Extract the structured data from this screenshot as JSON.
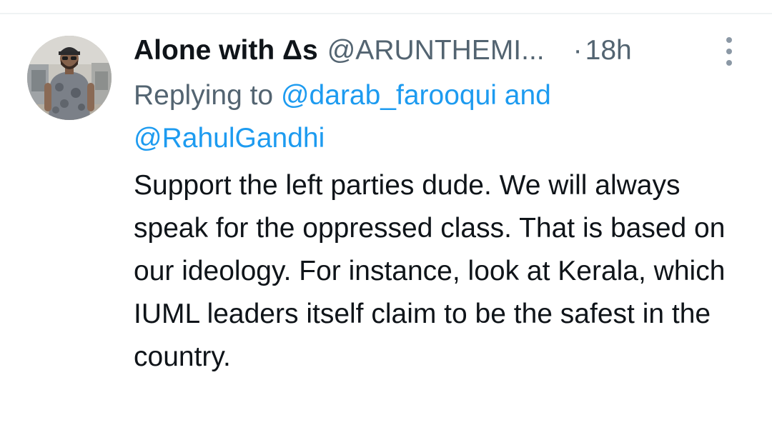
{
  "tweet": {
    "author": {
      "display_name": "Alone with Δs",
      "handle": "@ARUNTHEMI..."
    },
    "separator": "·",
    "timestamp": "18h",
    "more_icon": "more-vertical-icon",
    "reply_context": {
      "prefix": "Replying to",
      "mention_1": "@darab_farooqui",
      "conjunction": "and",
      "mention_2": "@RahulGandhi"
    },
    "text": "Support the left parties dude. We will always speak for the oppressed class. That is based on our ideology. For instance, look at Kerala, which IUML leaders itself claim to be the safest in the country."
  },
  "colors": {
    "primary_text": "#0f1419",
    "secondary_text": "#536471",
    "link": "#1d9bf0",
    "divider": "#eff3f4"
  }
}
